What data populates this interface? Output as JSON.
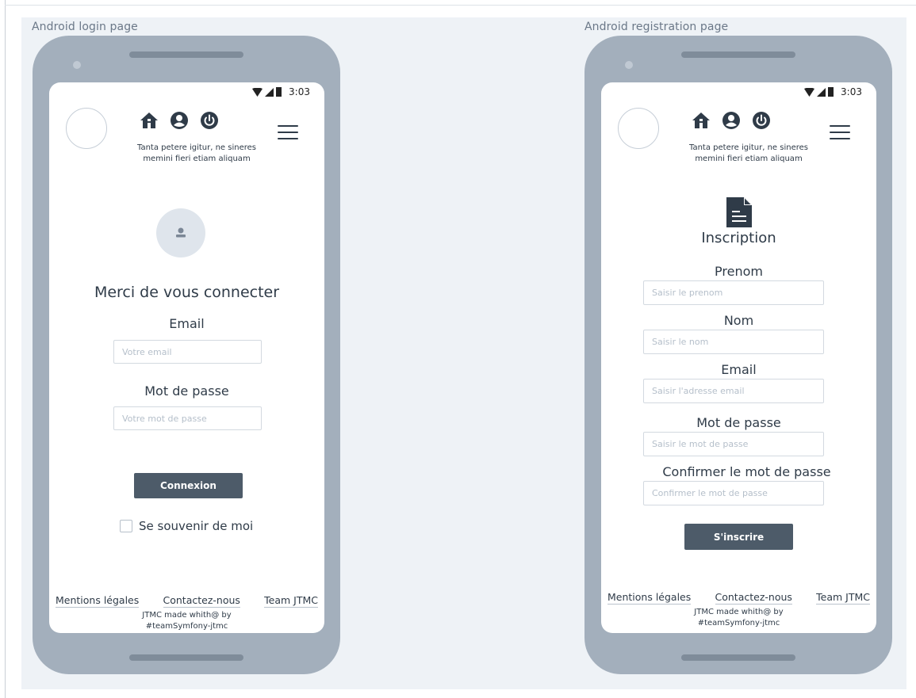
{
  "login": {
    "frame_title": "Android login page",
    "status_time": "3:03",
    "tagline_line1": "Tanta petere igitur, ne sineres",
    "tagline_line2": "memini fieri etiam aliquam",
    "heading": "Merci de vous connecter",
    "email_label": "Email",
    "email_placeholder": "Votre email",
    "password_label": "Mot de passe",
    "password_placeholder": "Votre mot de passe",
    "submit_label": "Connexion",
    "remember_label": "Se souvenir de moi",
    "footer": {
      "legal": "Mentions légales",
      "contact": "Contactez-nous",
      "team": "Team JTMC",
      "credit_line1": "JTMC made whith@ by",
      "credit_line2": "#teamSymfony-jtmc"
    }
  },
  "register": {
    "frame_title": "Android registration page",
    "status_time": "3:03",
    "tagline_line1": "Tanta petere igitur, ne sineres",
    "tagline_line2": "memini fieri etiam aliquam",
    "heading": "Inscription",
    "firstname_label": "Prenom",
    "firstname_placeholder": "Saisir le prenom",
    "lastname_label": "Nom",
    "lastname_placeholder": "Saisir le nom",
    "email_label": "Email",
    "email_placeholder": "Saisir l'adresse email",
    "password_label": "Mot de passe",
    "password_placeholder": "Saisir le mot de passe",
    "confirm_label": "Confirmer le mot de passe",
    "confirm_placeholder": "Confirmer le mot de passe",
    "submit_label": "S'inscrire",
    "footer": {
      "legal": "Mentions légales",
      "contact": "Contactez-nous",
      "team": "Team JTMC",
      "credit_line1": "JTMC made whith@ by",
      "credit_line2": "#teamSymfony-jtmc"
    }
  },
  "icons": {
    "home": "home-icon",
    "account": "account-icon",
    "power": "power-icon",
    "menu": "hamburger-menu-icon",
    "user": "user-icon",
    "document": "document-icon",
    "wifi": "wifi-icon",
    "signal": "signal-icon",
    "battery": "battery-icon"
  },
  "colors": {
    "phone_body": "#a3afbc",
    "canvas": "#eef2f6",
    "button": "#4d5b69",
    "text": "#2f3b48",
    "input_border": "#d3d9e0",
    "placeholder": "#b5bfca"
  }
}
